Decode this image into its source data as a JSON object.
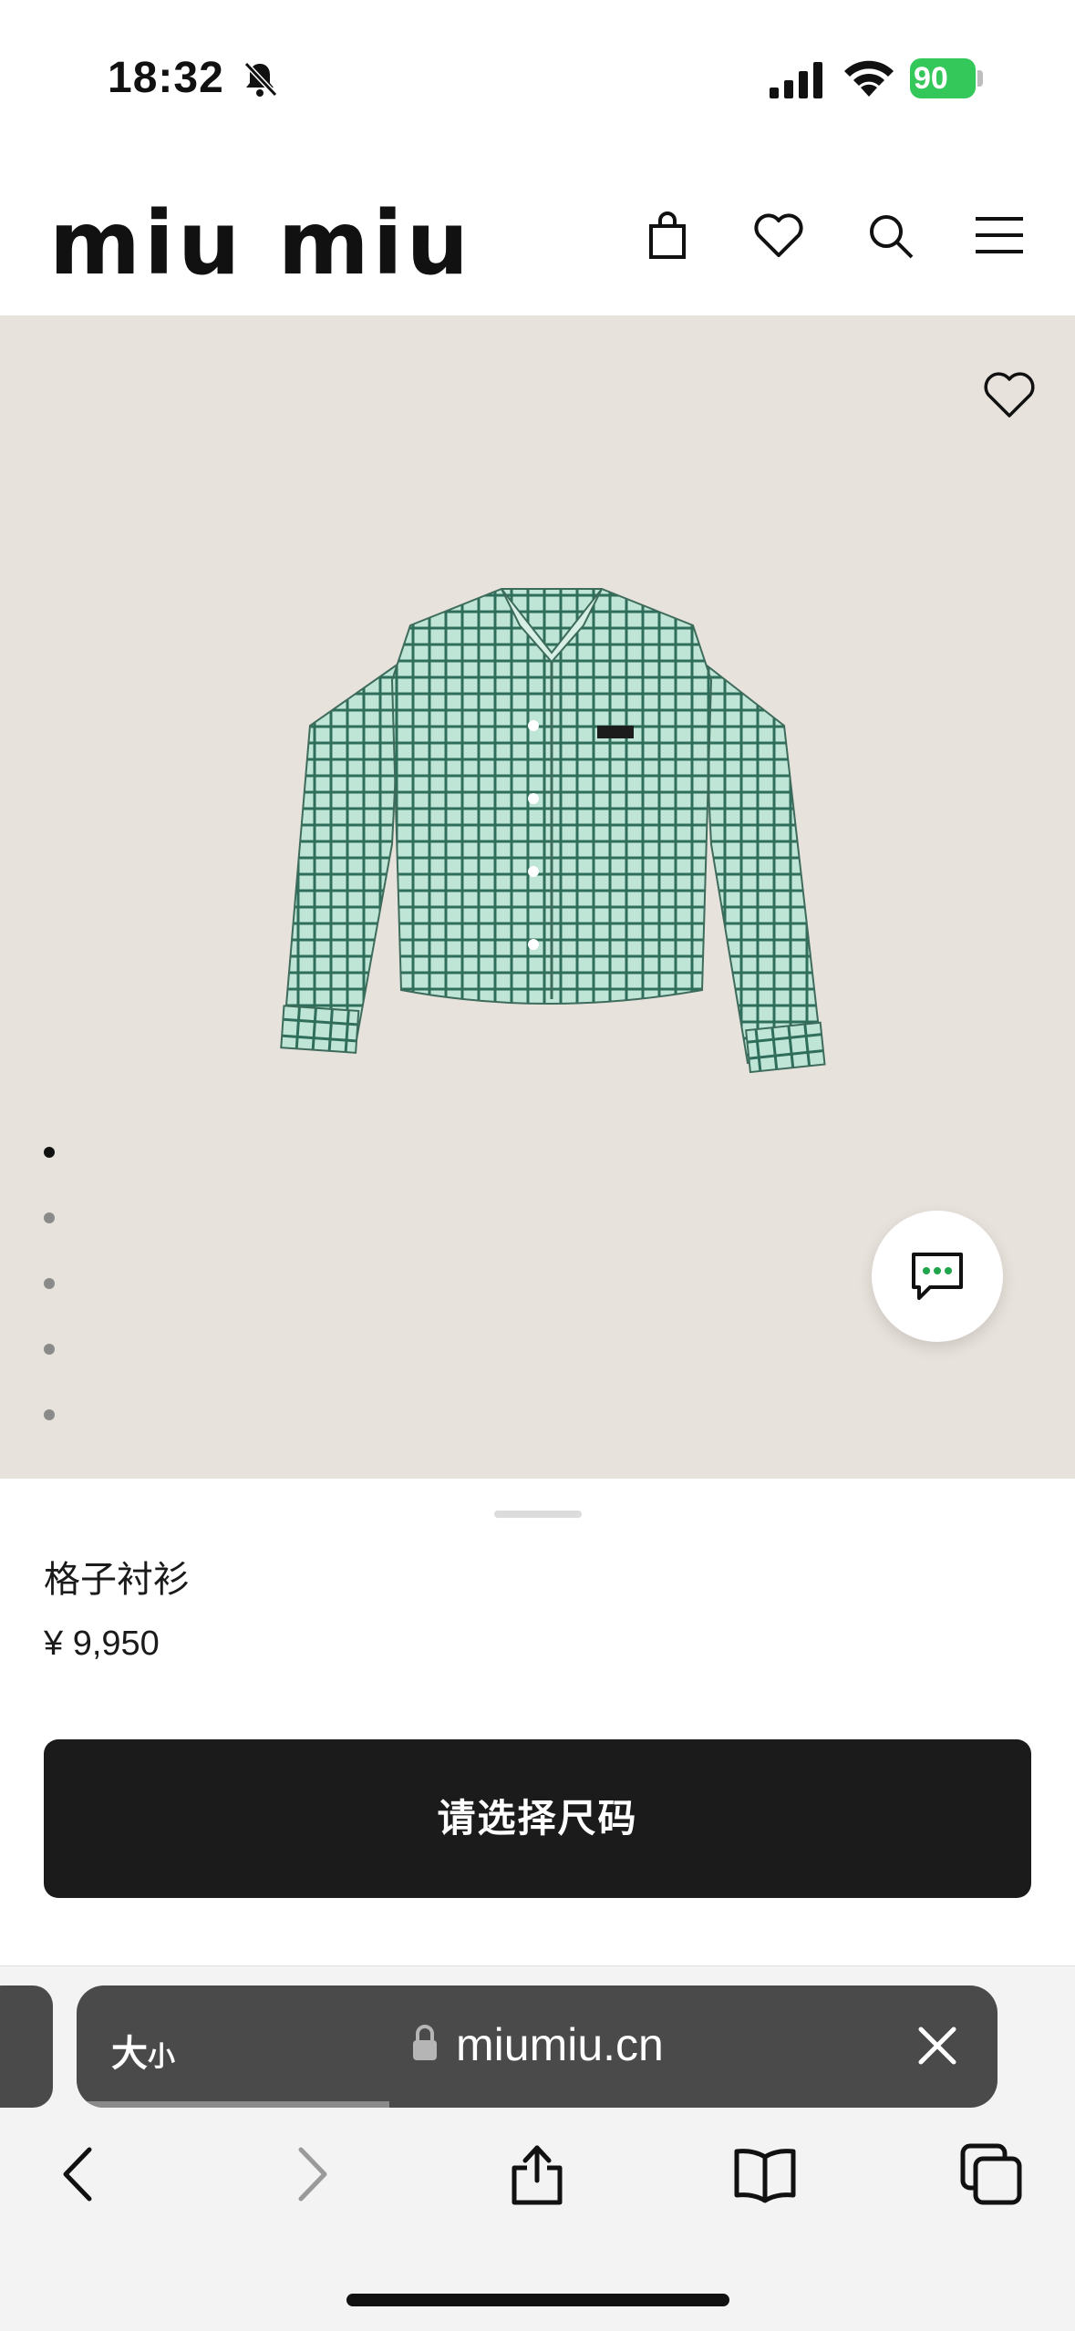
{
  "status_bar": {
    "time": "18:32",
    "battery": "90"
  },
  "header": {
    "logo": "miu miu",
    "icons": [
      "shopping-bag-icon",
      "heart-icon",
      "search-icon",
      "menu-icon"
    ]
  },
  "gallery": {
    "image_count": 5,
    "active_index": 1
  },
  "product": {
    "name": "格子衬衫",
    "price": "¥ 9,950",
    "cta_label": "请选择尺码"
  },
  "browser": {
    "text_size_label_big": "大",
    "text_size_label_small": "小",
    "url": "miumiu.cn",
    "load_progress": 0.34
  },
  "colors": {
    "accent_green": "#34c759",
    "cta_background": "#1b1b1b",
    "image_background": "#e7e2db"
  }
}
